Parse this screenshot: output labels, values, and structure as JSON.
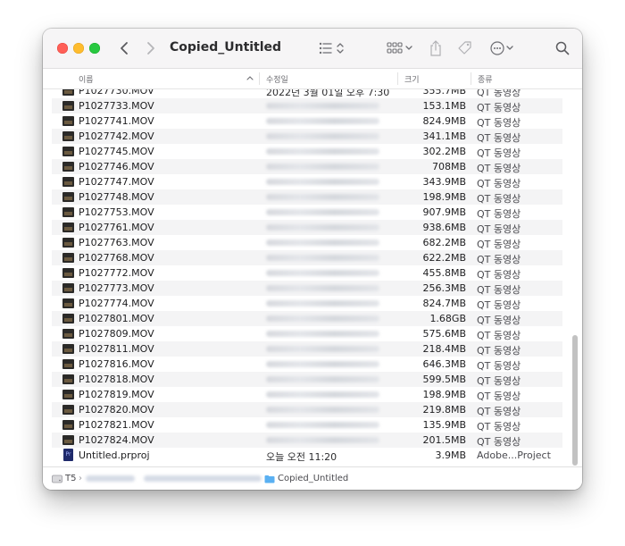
{
  "window": {
    "title": "Copied_Untitled"
  },
  "toolbar": {
    "back_icon": "chevron-left-icon",
    "forward_icon": "chevron-right-icon",
    "list_view_icon": "list-view-icon",
    "group_icon": "grid-view-icon",
    "share_icon": "share-icon",
    "tag_icon": "tag-icon",
    "more_icon": "ellipsis-circle-icon",
    "search_icon": "search-icon"
  },
  "columns": {
    "name": "이름",
    "date": "수정일",
    "size": "크기",
    "kind": "종류"
  },
  "files": [
    {
      "name": "P1027730.MOV",
      "date": "2022년 3월 01일 오후 7:30",
      "size": "355.7MB",
      "kind": "QT 동영상",
      "icon": "video-thumbnail-icon"
    },
    {
      "name": "P1027733.MOV",
      "size": "153.1MB",
      "kind": "QT 동영상",
      "icon": "video-thumbnail-icon"
    },
    {
      "name": "P1027741.MOV",
      "size": "824.9MB",
      "kind": "QT 동영상",
      "icon": "video-thumbnail-icon"
    },
    {
      "name": "P1027742.MOV",
      "size": "341.1MB",
      "kind": "QT 동영상",
      "icon": "video-thumbnail-icon"
    },
    {
      "name": "P1027745.MOV",
      "size": "302.2MB",
      "kind": "QT 동영상",
      "icon": "video-thumbnail-icon"
    },
    {
      "name": "P1027746.MOV",
      "size": "708MB",
      "kind": "QT 동영상",
      "icon": "video-thumbnail-icon"
    },
    {
      "name": "P1027747.MOV",
      "size": "343.9MB",
      "kind": "QT 동영상",
      "icon": "video-thumbnail-icon"
    },
    {
      "name": "P1027748.MOV",
      "size": "198.9MB",
      "kind": "QT 동영상",
      "icon": "video-thumbnail-icon"
    },
    {
      "name": "P1027753.MOV",
      "size": "907.9MB",
      "kind": "QT 동영상",
      "icon": "video-thumbnail-icon"
    },
    {
      "name": "P1027761.MOV",
      "size": "938.6MB",
      "kind": "QT 동영상",
      "icon": "video-thumbnail-icon"
    },
    {
      "name": "P1027763.MOV",
      "size": "682.2MB",
      "kind": "QT 동영상",
      "icon": "video-thumbnail-icon"
    },
    {
      "name": "P1027768.MOV",
      "size": "622.2MB",
      "kind": "QT 동영상",
      "icon": "video-thumbnail-icon"
    },
    {
      "name": "P1027772.MOV",
      "size": "455.8MB",
      "kind": "QT 동영상",
      "icon": "video-thumbnail-icon"
    },
    {
      "name": "P1027773.MOV",
      "size": "256.3MB",
      "kind": "QT 동영상",
      "icon": "video-thumbnail-icon"
    },
    {
      "name": "P1027774.MOV",
      "size": "824.7MB",
      "kind": "QT 동영상",
      "icon": "video-thumbnail-icon"
    },
    {
      "name": "P1027801.MOV",
      "size": "1.68GB",
      "kind": "QT 동영상",
      "icon": "video-thumbnail-icon"
    },
    {
      "name": "P1027809.MOV",
      "size": "575.6MB",
      "kind": "QT 동영상",
      "icon": "video-thumbnail-icon"
    },
    {
      "name": "P1027811.MOV",
      "size": "218.4MB",
      "kind": "QT 동영상",
      "icon": "video-thumbnail-icon"
    },
    {
      "name": "P1027816.MOV",
      "size": "646.3MB",
      "kind": "QT 동영상",
      "icon": "video-thumbnail-icon"
    },
    {
      "name": "P1027818.MOV",
      "size": "599.5MB",
      "kind": "QT 동영상",
      "icon": "video-thumbnail-icon"
    },
    {
      "name": "P1027819.MOV",
      "size": "198.9MB",
      "kind": "QT 동영상",
      "icon": "video-thumbnail-icon"
    },
    {
      "name": "P1027820.MOV",
      "size": "219.8MB",
      "kind": "QT 동영상",
      "icon": "video-thumbnail-icon"
    },
    {
      "name": "P1027821.MOV",
      "size": "135.9MB",
      "kind": "QT 동영상",
      "icon": "video-thumbnail-icon"
    },
    {
      "name": "P1027824.MOV",
      "size": "201.5MB",
      "kind": "QT 동영상",
      "icon": "video-thumbnail-icon"
    },
    {
      "name": "Untitled.prproj",
      "date": "오늘 오전 11:20",
      "size": "3.9MB",
      "kind": "Adobe...Project",
      "icon": "premiere-project-icon",
      "icon_text": "Pr"
    }
  ],
  "pathbar": {
    "root": "T5",
    "current": "Copied_Untitled",
    "drive_icon": "drive-icon",
    "folder_icon": "folder-icon"
  },
  "colors": {
    "close": "#ff5f57",
    "minimize": "#febc2e",
    "maximize": "#28c840",
    "folder": "#5ab0f2",
    "premiere": "#1f2a6b"
  }
}
